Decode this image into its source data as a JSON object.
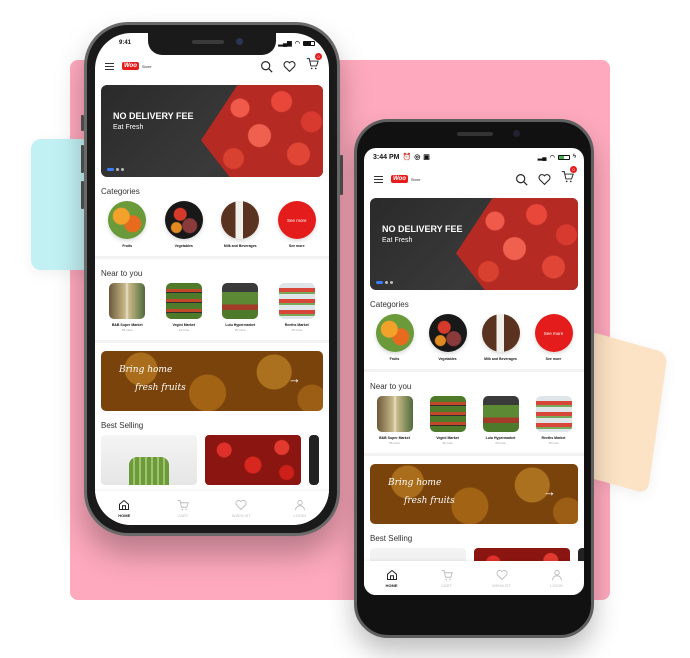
{
  "theme": {
    "brand_red": "#e41c1c",
    "indicator_blue": "#3b7ef6",
    "bg_pink": "#fea9bd",
    "bg_cyan": "#c2f1f4",
    "bg_peach": "#fde3c5"
  },
  "iphone": {
    "status_time": "9:41",
    "app": {
      "logo": "Woo",
      "logo_suffix": "Store",
      "cart_count": "0",
      "banner": {
        "title": "NO DELIVERY FEE",
        "subtitle": "Eat Fresh",
        "slides": 3,
        "active_slide": 1
      },
      "categories_title": "Categories",
      "categories": [
        {
          "label": "Fruits",
          "icon": "fruits-image"
        },
        {
          "label": "Vegetables",
          "icon": "vegetables-image"
        },
        {
          "label": "Milk and Beverages",
          "icon": "milk-image"
        },
        {
          "label": "See more",
          "badge": "See more"
        }
      ],
      "near_title": "Near to you",
      "stores": [
        {
          "name": "B&B Super Market",
          "time": "55 mins"
        },
        {
          "name": "Vegini Market",
          "time": "44 mins"
        },
        {
          "name": "Lulu Hypermarket",
          "time": "20 mins"
        },
        {
          "name": "Reeths Market",
          "time": "15 mins"
        }
      ],
      "promo": {
        "line1": "Bring home",
        "line2": "fresh fruits",
        "arrow": "→"
      },
      "best_title": "Best Selling",
      "tabs": [
        {
          "label": "HOME",
          "active": true
        },
        {
          "label": "CART",
          "active": false
        },
        {
          "label": "WISHLIST",
          "active": false
        },
        {
          "label": "LOGIN",
          "active": false
        }
      ]
    }
  },
  "android": {
    "status_time": "3:44 PM",
    "app": {
      "logo": "Woo",
      "logo_suffix": "Store",
      "cart_count": "0",
      "banner": {
        "title": "NO DELIVERY FEE",
        "subtitle": "Eat Fresh",
        "slides": 3,
        "active_slide": 1
      },
      "categories_title": "Categories",
      "categories": [
        {
          "label": "Fruits"
        },
        {
          "label": "Vegetables"
        },
        {
          "label": "Milk and Beverages"
        },
        {
          "label": "See more",
          "badge": "See more"
        }
      ],
      "near_title": "Near to you",
      "stores": [
        {
          "name": "B&B Super Market",
          "time": "55 mins"
        },
        {
          "name": "Vegini Market",
          "time": "44 mins"
        },
        {
          "name": "Lulu Hypermarket",
          "time": "20 mins"
        },
        {
          "name": "Reeths Market",
          "time": "15 mins"
        }
      ],
      "promo": {
        "line1": "Bring home",
        "line2": "fresh fruits",
        "arrow": "→"
      },
      "best_title": "Best Selling",
      "tabs": [
        {
          "label": "HOME",
          "active": true
        },
        {
          "label": "CART",
          "active": false
        },
        {
          "label": "WISHLIST",
          "active": false
        },
        {
          "label": "LOGIN",
          "active": false
        }
      ]
    }
  }
}
